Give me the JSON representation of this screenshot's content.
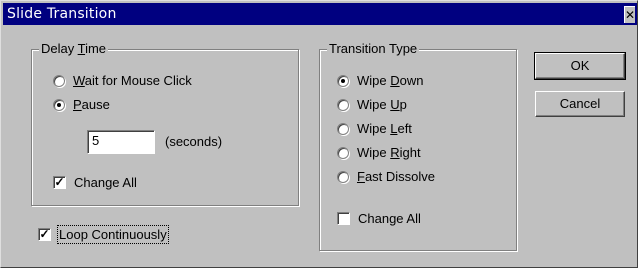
{
  "dialog": {
    "title": "Slide Transition",
    "close_label": "✕"
  },
  "delay_time": {
    "legend_pre": "Delay ",
    "legend_u": "T",
    "legend_post": "ime",
    "wait_u": "W",
    "wait_rest": "ait for Mouse Click",
    "pause_u": "P",
    "pause_rest": "ause",
    "seconds_value": "5",
    "seconds_unit": "(seconds)",
    "change_all": "Change All",
    "change_all_mark": "✓"
  },
  "loop": {
    "label": "Loop Continuously",
    "mark": "✓"
  },
  "transition_type": {
    "legend": "Transition Type",
    "options": [
      {
        "pre": "Wipe ",
        "u": "D",
        "post": "own"
      },
      {
        "pre": "Wipe ",
        "u": "U",
        "post": "p"
      },
      {
        "pre": "Wipe ",
        "u": "L",
        "post": "eft"
      },
      {
        "pre": "Wipe ",
        "u": "R",
        "post": "ight"
      },
      {
        "pre": "",
        "u": "F",
        "post": "ast Dissolve"
      }
    ],
    "selected": "Wipe Down",
    "change_all": "Change All"
  },
  "buttons": {
    "ok": "OK",
    "cancel": "Cancel"
  }
}
